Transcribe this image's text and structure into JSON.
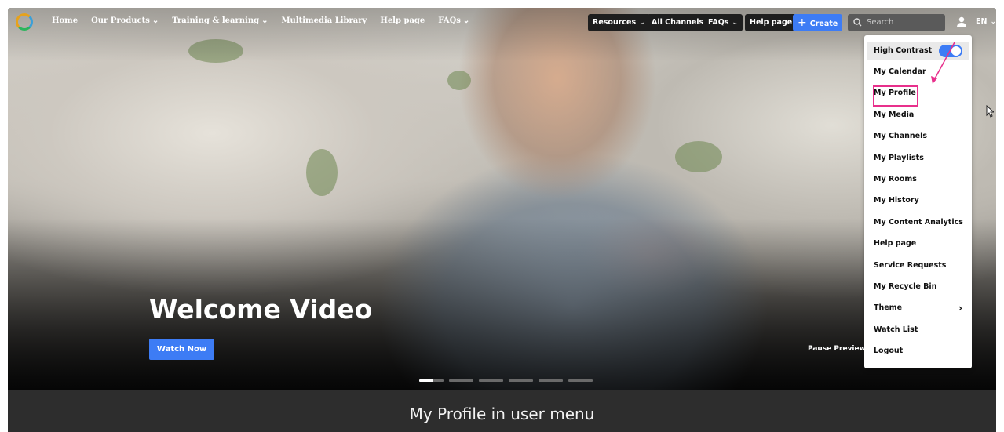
{
  "nav": {
    "links": [
      {
        "label": "Home",
        "chevron": false
      },
      {
        "label": "Our Products",
        "chevron": true
      },
      {
        "label": "Training & learning",
        "chevron": true
      },
      {
        "label": "Multimedia Library",
        "chevron": false
      },
      {
        "label": "Help page",
        "chevron": false
      },
      {
        "label": "FAQs",
        "chevron": true
      }
    ],
    "resources": "Resources",
    "all_channels": "All Channels",
    "faqs": "FAQs",
    "help_page": "Help page",
    "create": "Create",
    "search_placeholder": "Search",
    "language": "EN"
  },
  "user_menu": {
    "high_contrast": "High Contrast",
    "high_contrast_on": true,
    "items": [
      "My Calendar",
      "My Profile",
      "My Media",
      "My Channels",
      "My Playlists",
      "My Rooms",
      "My History",
      "My Content Analytics",
      "Help page",
      "Service Requests",
      "My Recycle Bin",
      "Theme",
      "Watch List",
      "Logout"
    ],
    "highlighted": "My Profile"
  },
  "hero": {
    "title": "Welcome Video",
    "watch_button": "Watch Now",
    "pause_label": "Pause Preview",
    "slides": 6,
    "active_slide": 1
  },
  "caption": "My Profile in user menu",
  "colors": {
    "accent": "#3d7cf5",
    "highlight": "#e8308c"
  }
}
